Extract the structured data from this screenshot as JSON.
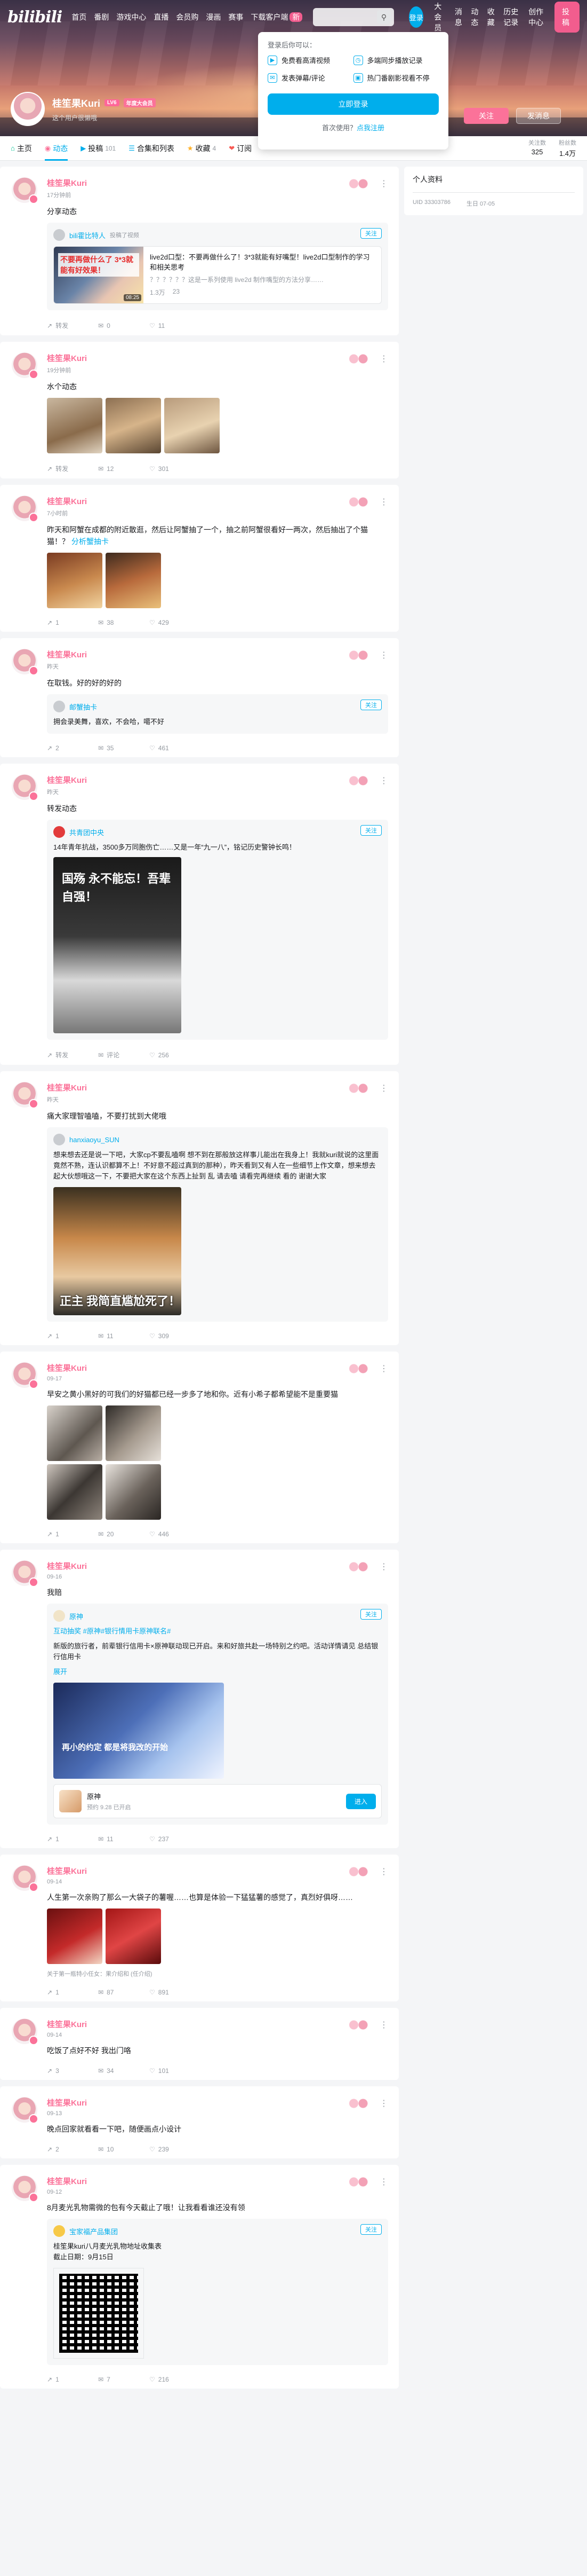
{
  "header": {
    "logo": "bilibili",
    "nav": [
      "首页",
      "番剧",
      "游戏中心",
      "直播",
      "会员购",
      "漫画",
      "赛事",
      "下载客户端"
    ],
    "download_badge": "新",
    "search_icon": "search-icon",
    "login_avatar": "登录",
    "right_links": [
      "大会员",
      "消息",
      "动态",
      "收藏",
      "历史记录",
      "创作中心"
    ],
    "post_button": "投稿"
  },
  "login_popup": {
    "title": "登录后你可以：",
    "perks": [
      "免费看高清视频",
      "多端同步播放记录",
      "发表弹幕/评论",
      "热门番剧影视看不停"
    ],
    "login_button": "立即登录",
    "register_prompt": "首次使用？",
    "register_link": "点我注册"
  },
  "profile": {
    "name": "桂笙果Kuri",
    "level_badge": "LV6",
    "vip_badge": "年度大会员",
    "sign": "这个用户很懒哦",
    "follow_button": "关注",
    "message_button": "发消息"
  },
  "tabs": [
    {
      "label": "主页",
      "count": "",
      "icon": "home-icon"
    },
    {
      "label": "动态",
      "count": "",
      "icon": "feed-icon"
    },
    {
      "label": "投稿",
      "count": "101",
      "icon": "video-icon"
    },
    {
      "label": "合集和列表",
      "count": "",
      "icon": "list-icon"
    },
    {
      "label": "收藏",
      "count": "4",
      "icon": "star-icon"
    },
    {
      "label": "订阅",
      "count": "",
      "icon": "subscribe-icon"
    }
  ],
  "stats": [
    {
      "label": "关注数",
      "value": "325"
    },
    {
      "label": "粉丝数",
      "value": "1.4万"
    }
  ],
  "sidebar": {
    "title": "个人资料",
    "uid": "UID 33303786",
    "birthday": "生日 07-05"
  },
  "posts": [
    {
      "time": "17分钟前",
      "text": "分享动态",
      "repost": {
        "author": "bili霍比特人",
        "tag": "投稿了视频",
        "video_title": "live2d口型：不要再做什么了！3*3就能有好嘴型！live2d口型制作的学习和相关思考",
        "video_desc": "？？？？？？这是一系列使用 live2d 制作嘴型的方法分享……",
        "video_label": "不要再做什么了 3*3就能有好效果！",
        "duration": "08:25",
        "plays": "1.3万",
        "danmaku": "23"
      },
      "actions": [
        "转发",
        "0",
        "11"
      ]
    },
    {
      "time": "19分钟前",
      "text": "水个动态",
      "actions": [
        "转发",
        "12",
        "301"
      ]
    },
    {
      "time": "7小时前",
      "text": "昨天和阿蟹在成都的附近散逛，然后让阿蟹抽了一个，抽之前阿蟹很看好一两次，然后抽出了个猫猫！？",
      "link": "分析蟹抽卡",
      "actions": [
        "1",
        "38",
        "429"
      ]
    },
    {
      "time": "昨天",
      "text": "在取钱。好的好的好的",
      "repost": {
        "author": "邮蟹抽卡",
        "rtext": "拥会录美舞，喜欢，不会哈，噶不好"
      },
      "actions": [
        "2",
        "35",
        "461"
      ]
    },
    {
      "time": "昨天",
      "text": "转发动态",
      "repost": {
        "author": "共青团中央",
        "rtext": "14年青年抗战，3500多万同胞伤亡……又是一年“九一八”，铭记历史警钟长鸣！",
        "image_caption": "国殇 永不能忘！吾辈自强！"
      },
      "actions": [
        "转发",
        "评论",
        "256"
      ]
    },
    {
      "time": "昨天",
      "text": "痛大家理智嗑嗑，不要打扰到大佬哦",
      "repost": {
        "author": "hanxiaoyu_SUN",
        "rtext": "想来想去还是说一下吧，大家cp不要乱嗑啊 想不到在那般放这样事儿能出在我身上！我就kuri就说的这里面竟然不熟，连认识都算不上！不好意不超过真到的那种），昨天看到又有人在一些细节上作文章，想来想去起大伙想哦这一下，不要把大家在这个东西上扯到 乱 请去嗑 请看完再继续 看的 谢谢大家",
        "image_caption": "正主 我简直尴尬死了！"
      },
      "actions": [
        "1",
        "11",
        "309"
      ]
    },
    {
      "time": "09-17",
      "text": "早安之黄小黑好的可我们的好猫都已经一步多了地和你。近有小希子都希望能不是重要猫",
      "actions": [
        "1",
        "20",
        "446"
      ]
    },
    {
      "time": "09-16",
      "text": "我赔",
      "repost": {
        "author": "原神",
        "tag": "互动抽奖 #原神#银行情用卡原神联名#",
        "rtext": "新版的旅行者，前辈银行信用卡×原神联动现已开启。来和好旅共赴一场特别之约吧。活动详情请见 总结银行信用卡",
        "expand": "展开",
        "image_caption": "再小的约定 都是将我改的开始",
        "link_title": "原神",
        "link_sub": "预约 9.28 已开启",
        "link_button": "进入"
      },
      "actions": [
        "1",
        "11",
        "237"
      ]
    },
    {
      "time": "09-14",
      "text": "人生第一次亲购了那么一大袋子的薯喔……也算是体验一下猛猛薯的感觉了，真烈好俱呀……",
      "footer": "关于第一瓶特小任女：果介绍和 (任介绍)",
      "actions": [
        "1",
        "87",
        "891"
      ]
    },
    {
      "time": "09-14",
      "text": "吃饭了点好不好 我出门咯",
      "actions": [
        "3",
        "34",
        "101"
      ]
    },
    {
      "time": "09-13",
      "text": "晚点回家就看看一下吧，随便画点小设计",
      "actions": [
        "2",
        "10",
        "239"
      ]
    },
    {
      "time": "09-12",
      "text": "8月麦光乳物需微的包有今天截止了哦！让我看看谁还没有领",
      "repost": {
        "author": "宝家福产品集团",
        "rtext": "桂笙果kuri八月麦光乳物地址收集表\n截止日期：9月15日"
      },
      "actions": [
        "1",
        "7",
        "216"
      ]
    }
  ]
}
